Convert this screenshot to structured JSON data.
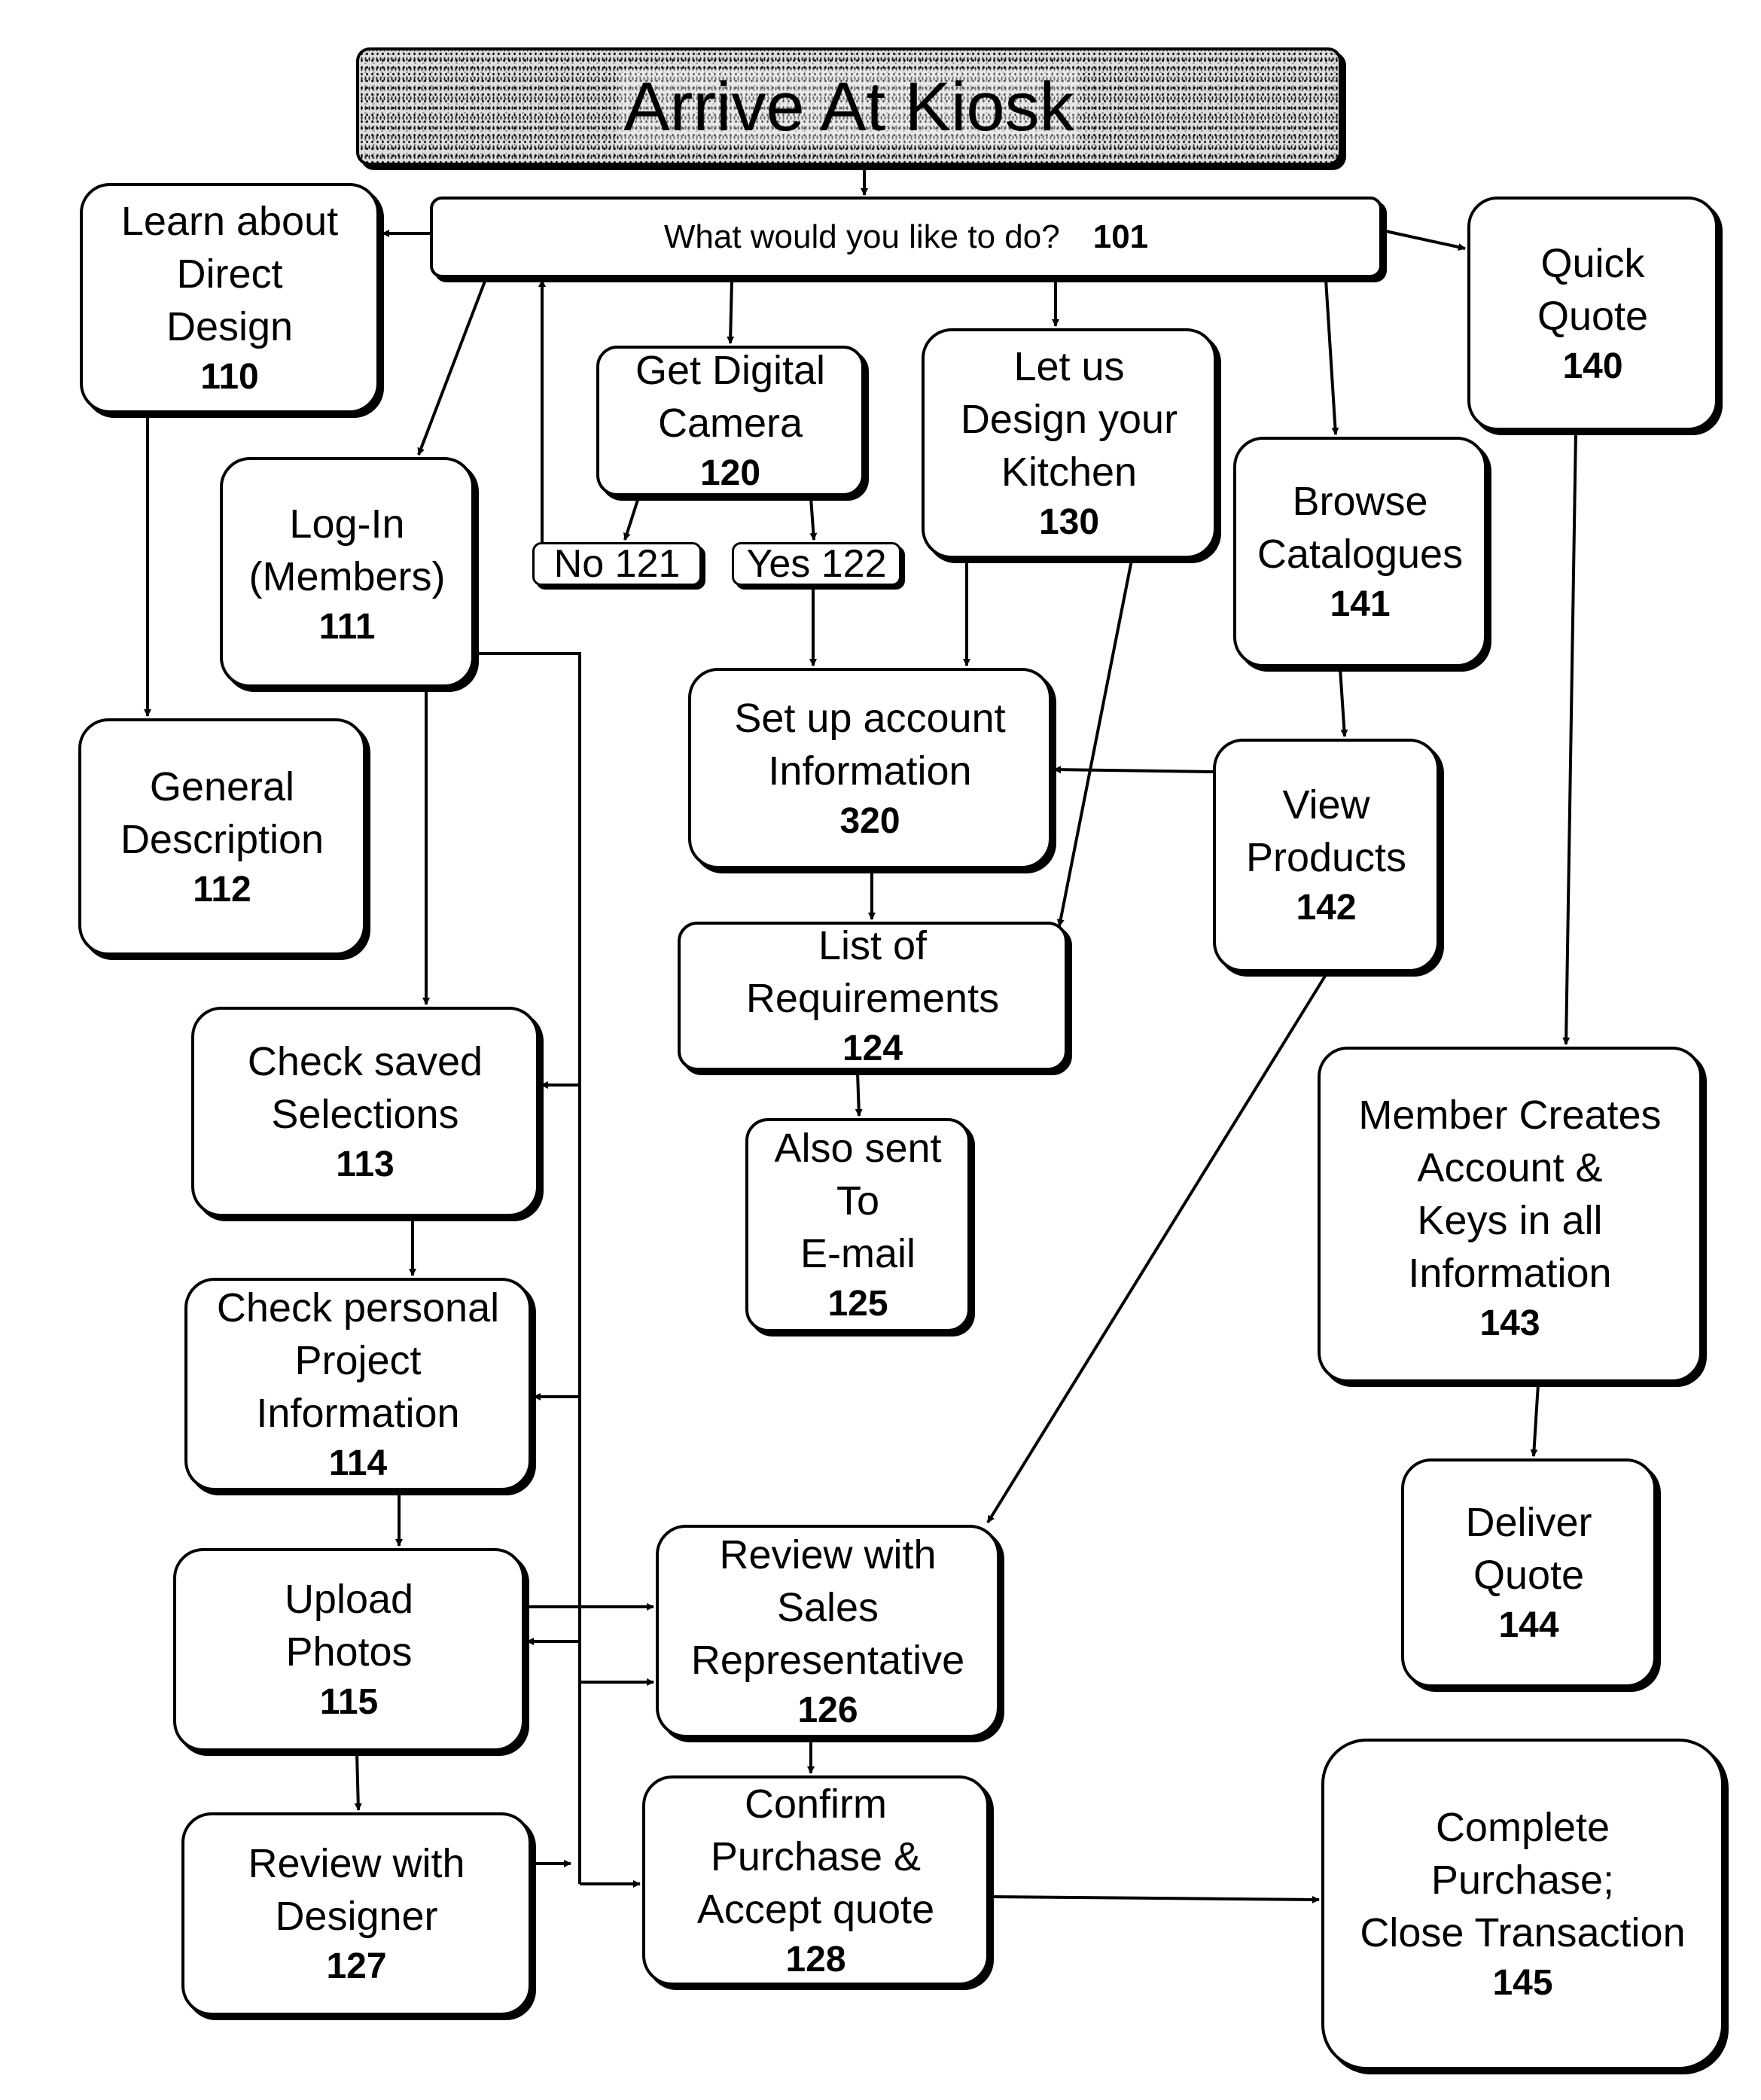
{
  "diagram": {
    "title": "Arrive At Kiosk",
    "prompt": {
      "label": "What would you like to do?",
      "num": "101"
    },
    "nodes": {
      "n110": {
        "label": "Learn about\nDirect\nDesign",
        "num": "110"
      },
      "n111": {
        "label": "Log-In\n(Members)",
        "num": "111"
      },
      "n112": {
        "label": "General\nDescription",
        "num": "112"
      },
      "n113": {
        "label": "Check saved\nSelections",
        "num": "113"
      },
      "n114": {
        "label": "Check personal\nProject\nInformation",
        "num": "114"
      },
      "n115": {
        "label": "Upload\nPhotos",
        "num": "115"
      },
      "n127": {
        "label": "Review with\nDesigner",
        "num": "127"
      },
      "n120": {
        "label": "Get Digital\nCamera",
        "num": "120"
      },
      "n121": {
        "label": "No",
        "num": "121"
      },
      "n122": {
        "label": "Yes",
        "num": "122"
      },
      "n130": {
        "label": "Let us\nDesign your\nKitchen",
        "num": "130"
      },
      "n320": {
        "label": "Set up account\nInformation",
        "num": "320"
      },
      "n124": {
        "label": "List of\nRequirements",
        "num": "124"
      },
      "n125": {
        "label": "Also sent\nTo\nE-mail",
        "num": "125"
      },
      "n126": {
        "label": "Review with\nSales\nRepresentative",
        "num": "126"
      },
      "n128": {
        "label": "Confirm\nPurchase &\nAccept quote",
        "num": "128"
      },
      "n141": {
        "label": "Browse\nCatalogues",
        "num": "141"
      },
      "n142": {
        "label": "View\nProducts",
        "num": "142"
      },
      "n140": {
        "label": "Quick\nQuote",
        "num": "140"
      },
      "n143": {
        "label": "Member Creates\nAccount &\nKeys in all\nInformation",
        "num": "143"
      },
      "n144": {
        "label": "Deliver\nQuote",
        "num": "144"
      },
      "n145": {
        "label": "Complete\nPurchase;\nClose Transaction",
        "num": "145"
      }
    },
    "edges": [
      [
        "title",
        "101"
      ],
      [
        "101",
        "110"
      ],
      [
        "101",
        "111"
      ],
      [
        "101",
        "120"
      ],
      [
        "101",
        "130"
      ],
      [
        "101",
        "141"
      ],
      [
        "101",
        "140"
      ],
      [
        "110",
        "112"
      ],
      [
        "120",
        "121"
      ],
      [
        "120",
        "122"
      ],
      [
        "121",
        "101"
      ],
      [
        "122",
        "320"
      ],
      [
        "130",
        "320"
      ],
      [
        "130",
        "124"
      ],
      [
        "141",
        "142"
      ],
      [
        "142",
        "320"
      ],
      [
        "142",
        "126"
      ],
      [
        "320",
        "124"
      ],
      [
        "124",
        "125"
      ],
      [
        "111",
        "113"
      ],
      [
        "111",
        "114"
      ],
      [
        "111",
        "115"
      ],
      [
        "111",
        "126"
      ],
      [
        "111",
        "128"
      ],
      [
        "113",
        "114"
      ],
      [
        "114",
        "115"
      ],
      [
        "115",
        "126"
      ],
      [
        "115",
        "127"
      ],
      [
        "127",
        "128"
      ],
      [
        "126",
        "128"
      ],
      [
        "128",
        "145"
      ],
      [
        "140",
        "143"
      ],
      [
        "143",
        "144"
      ]
    ]
  }
}
